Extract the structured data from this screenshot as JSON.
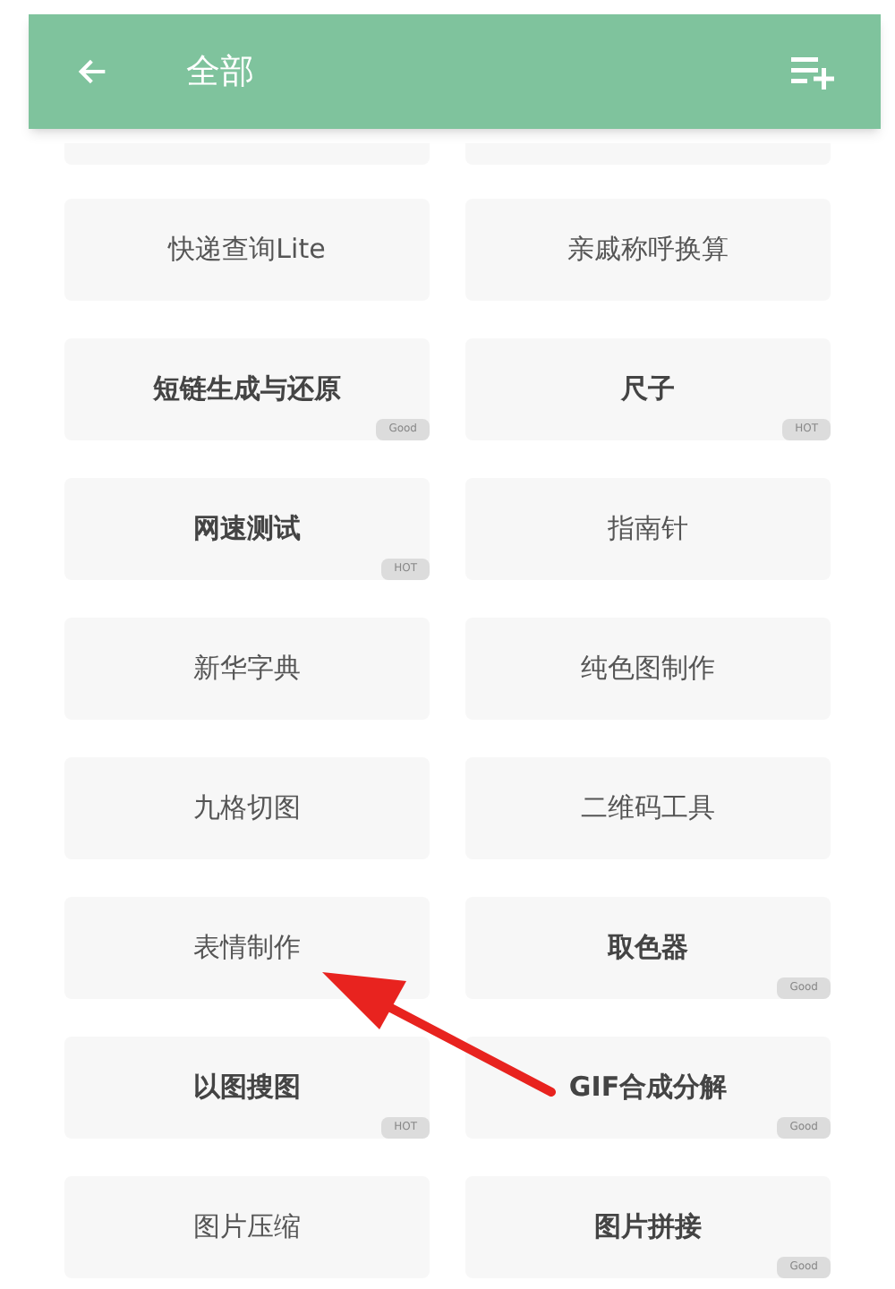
{
  "header": {
    "title": "全部"
  },
  "tools": [
    {
      "name": "快递查询Lite",
      "bold": false
    },
    {
      "name": "亲戚称呼换算",
      "bold": false
    },
    {
      "name": "短链生成与还原",
      "bold": true,
      "badge": "Good"
    },
    {
      "name": "尺子",
      "bold": true,
      "badge": "HOT"
    },
    {
      "name": "网速测试",
      "bold": true,
      "badge": "HOT"
    },
    {
      "name": "指南针",
      "bold": false
    },
    {
      "name": "新华字典",
      "bold": false
    },
    {
      "name": "纯色图制作",
      "bold": false
    },
    {
      "name": "九格切图",
      "bold": false
    },
    {
      "name": "二维码工具",
      "bold": false
    },
    {
      "name": "表情制作",
      "bold": false
    },
    {
      "name": "取色器",
      "bold": true,
      "badge": "Good"
    },
    {
      "name": "以图搜图",
      "bold": true,
      "badge": "HOT"
    },
    {
      "name": "GIF合成分解",
      "bold": true,
      "badge": "Good"
    },
    {
      "name": "图片压缩",
      "bold": false
    },
    {
      "name": "图片拼接",
      "bold": true,
      "badge": "Good"
    }
  ]
}
